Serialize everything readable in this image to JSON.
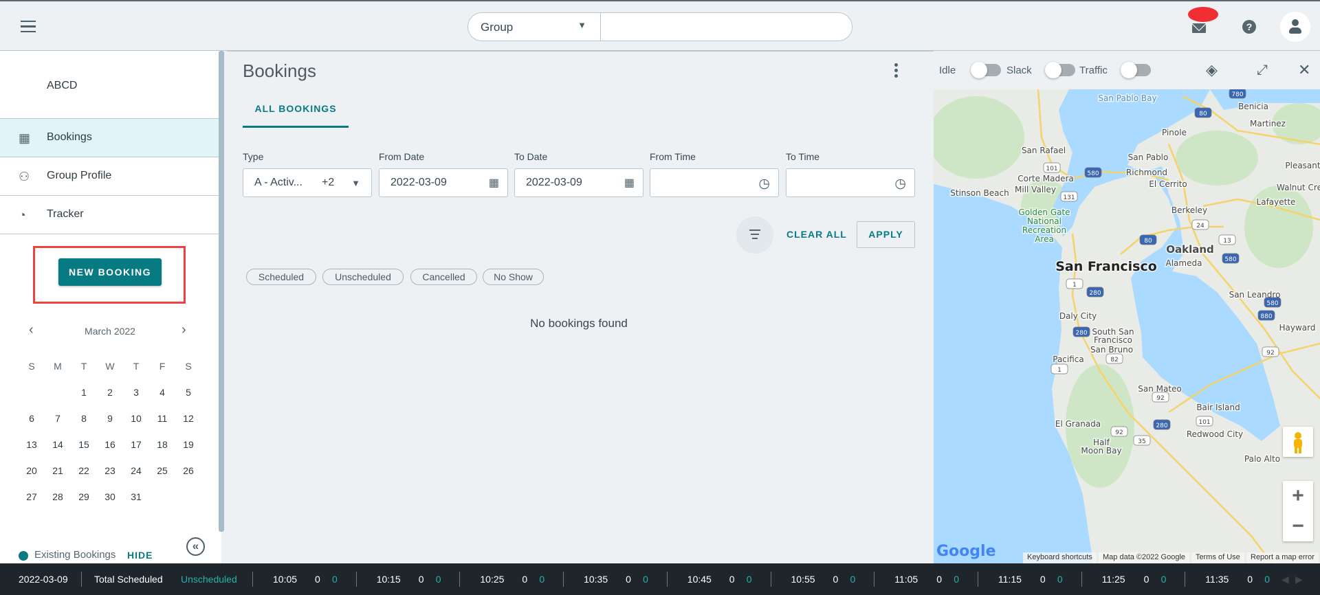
{
  "header": {
    "search_scope": "Group",
    "search_value": "",
    "icons": [
      "menu-icon",
      "mail-icon",
      "help-icon",
      "user-icon"
    ]
  },
  "sidebar": {
    "account_name": "ABCD",
    "nav": [
      {
        "label": "Bookings",
        "icon": "calendar-icon",
        "active": true
      },
      {
        "label": "Group Profile",
        "icon": "group-icon",
        "active": false
      },
      {
        "label": "Tracker",
        "icon": "tracker-icon",
        "active": false
      }
    ],
    "new_booking_label": "NEW BOOKING",
    "calendar": {
      "month_label": "March 2022",
      "weekdays": [
        "S",
        "M",
        "T",
        "W",
        "T",
        "F",
        "S"
      ],
      "weeks": [
        [
          "",
          "",
          "1",
          "2",
          "3",
          "4",
          "5"
        ],
        [
          "6",
          "7",
          "8",
          "9",
          "10",
          "11",
          "12"
        ],
        [
          "13",
          "14",
          "15",
          "16",
          "17",
          "18",
          "19"
        ],
        [
          "20",
          "21",
          "22",
          "23",
          "24",
          "25",
          "26"
        ],
        [
          "27",
          "28",
          "29",
          "30",
          "31",
          "",
          ""
        ]
      ]
    },
    "legend_label": "Existing Bookings",
    "hide_label": "HIDE"
  },
  "main": {
    "title": "Bookings",
    "tab": "ALL BOOKINGS",
    "filters": {
      "type_label": "Type",
      "type_value": "A - Activ...",
      "type_extra": "+2",
      "from_date_label": "From Date",
      "from_date_value": "2022-03-09",
      "to_date_label": "To Date",
      "to_date_value": "2022-03-09",
      "from_time_label": "From Time",
      "from_time_value": "",
      "to_time_label": "To Time",
      "to_time_value": ""
    },
    "clear_all_label": "CLEAR ALL",
    "apply_label": "APPLY",
    "status_chips": [
      "Scheduled",
      "Unscheduled",
      "Cancelled",
      "No Show"
    ],
    "empty_message": "No bookings found"
  },
  "map": {
    "toggles": [
      {
        "label": "Idle",
        "on": false
      },
      {
        "label": "Slack",
        "on": false
      },
      {
        "label": "Traffic",
        "on": false
      }
    ],
    "labels": [
      "San Pablo Bay",
      "Benicia",
      "Martinez",
      "Pinole",
      "San Rafael",
      "San Pablo",
      "Pleasant",
      "Richmond",
      "Corte Madera",
      "El Cerrito",
      "Walnut Cre",
      "Stinson Beach",
      "Mill Valley",
      "Lafayette",
      "Golden Gate",
      "National",
      "Recreation",
      "Area",
      "Berkeley",
      "Oakland",
      "Alameda",
      "San Francisco",
      "San Leandro",
      "Daly City",
      "Hayward",
      "South San",
      "Francisco",
      "San Bruno",
      "Pacifica",
      "San Mateo",
      "Bair Island",
      "El Granada",
      "Redwood City",
      "Half",
      "Moon Bay",
      "Palo Alto"
    ],
    "shields": [
      "780",
      "80",
      "101",
      "580",
      "131",
      "24",
      "80",
      "13",
      "580",
      "1",
      "280",
      "580",
      "880",
      "280",
      "82",
      "92",
      "1",
      "92",
      "101",
      "280",
      "92",
      "35"
    ],
    "logo": "Google",
    "attribution": [
      "Keyboard shortcuts",
      "Map data ©2022 Google",
      "Terms of Use",
      "Report a map error"
    ]
  },
  "footer": {
    "date": "2022-03-09",
    "total_label": "Total Scheduled",
    "unscheduled_label": "Unscheduled",
    "slots": [
      {
        "time": "10:05",
        "total": "0",
        "unscheduled": "0"
      },
      {
        "time": "10:15",
        "total": "0",
        "unscheduled": "0"
      },
      {
        "time": "10:25",
        "total": "0",
        "unscheduled": "0"
      },
      {
        "time": "10:35",
        "total": "0",
        "unscheduled": "0"
      },
      {
        "time": "10:45",
        "total": "0",
        "unscheduled": "0"
      },
      {
        "time": "10:55",
        "total": "0",
        "unscheduled": "0"
      },
      {
        "time": "11:05",
        "total": "0",
        "unscheduled": "0"
      },
      {
        "time": "11:15",
        "total": "0",
        "unscheduled": "0"
      },
      {
        "time": "11:25",
        "total": "0",
        "unscheduled": "0"
      },
      {
        "time": "11:35",
        "total": "0",
        "unscheduled": "0"
      }
    ]
  },
  "colors": {
    "accent": "#087a82",
    "teal_text": "#26b3a8",
    "badge": "#f02e33",
    "active_nav_bg": "#dff5f8",
    "water": "#aadaff"
  }
}
